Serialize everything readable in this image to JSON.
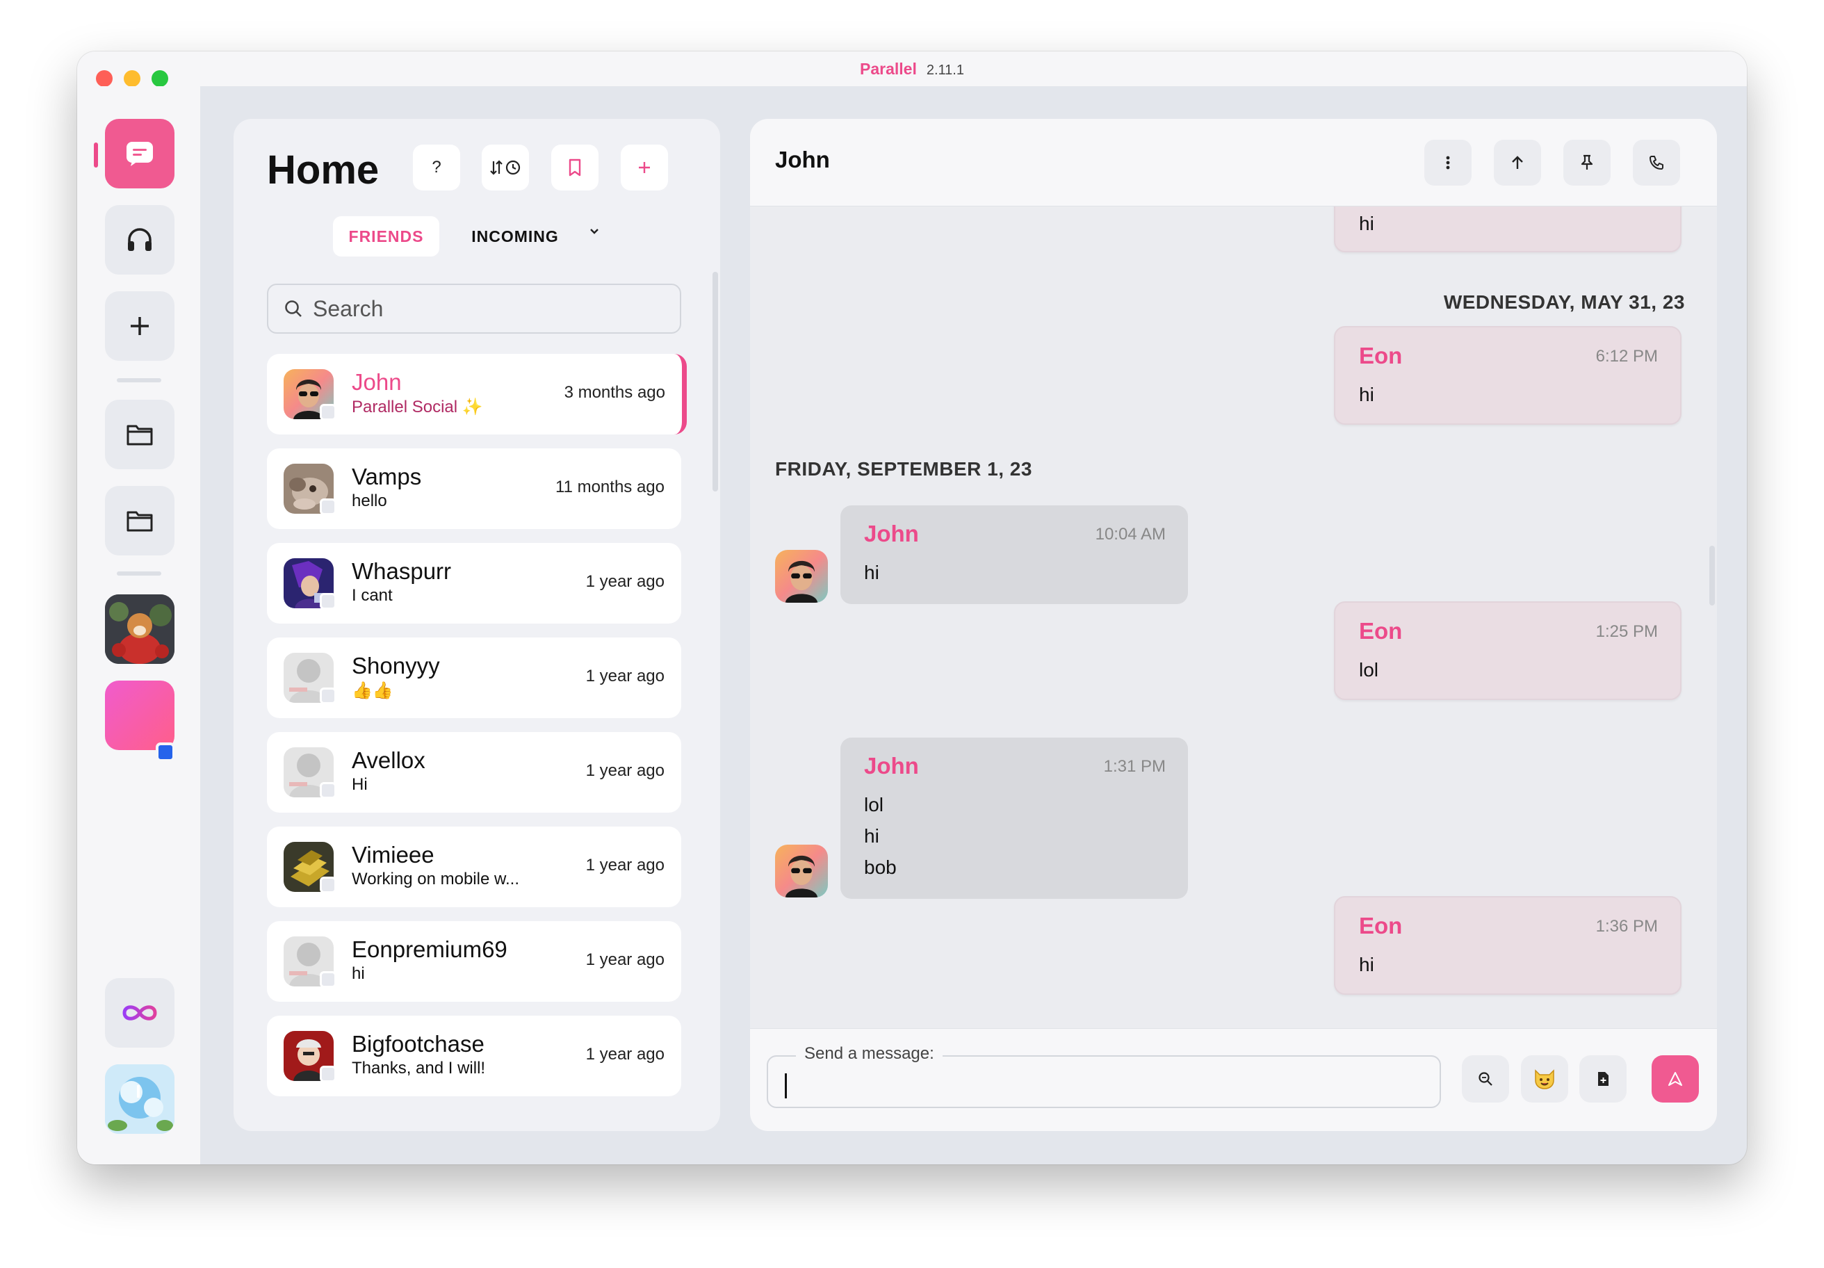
{
  "window": {
    "app_name": "Parallel",
    "version": "2.11.1"
  },
  "rail": {
    "items": [
      "chat-icon",
      "headphones-icon",
      "plus-icon",
      "folder-icon",
      "folder-icon",
      "server-shiba",
      "server-pink",
      "infinity-icon",
      "profile-avatar"
    ]
  },
  "home": {
    "title": "Home",
    "help_label": "?",
    "tabs": {
      "friends": "FRIENDS",
      "incoming": "INCOMING"
    },
    "search_placeholder": "Search",
    "friends": [
      {
        "name": "John",
        "status": "Parallel Social ✨",
        "time": "3 months ago",
        "active": true
      },
      {
        "name": "Vamps",
        "status": "hello",
        "time": "11 months ago"
      },
      {
        "name": "Whaspurr",
        "status": "I cant",
        "time": "1 year ago"
      },
      {
        "name": "Shonyyy",
        "status": "👍👍",
        "time": "1 year ago"
      },
      {
        "name": "Avellox",
        "status": "Hi",
        "time": "1 year ago"
      },
      {
        "name": "Vimieee",
        "status": "Working on mobile w...",
        "time": "1 year ago"
      },
      {
        "name": "Eonpremium69",
        "status": "hi",
        "time": "1 year ago"
      },
      {
        "name": "Bigfootchase",
        "status": "Thanks, and I will!",
        "time": "1 year ago"
      }
    ]
  },
  "chat": {
    "title": "John",
    "messages": {
      "top_partial_text": "hi",
      "date1": "WEDNESDAY, MAY 31, 23",
      "m1": {
        "author": "Eon",
        "time": "6:12 PM",
        "text": "hi"
      },
      "date2": "FRIDAY, SEPTEMBER 1, 23",
      "m2": {
        "author": "John",
        "time": "10:04 AM",
        "text": "hi"
      },
      "m3": {
        "author": "Eon",
        "time": "1:25 PM",
        "text": "lol"
      },
      "m4": {
        "author": "John",
        "time": "1:31 PM",
        "lines": [
          "lol",
          "hi",
          "bob"
        ]
      },
      "m5": {
        "author": "Eon",
        "time": "1:36 PM",
        "text": "hi"
      }
    },
    "composer": {
      "label": "Send a message:",
      "value": ""
    }
  },
  "colors": {
    "accent": "#ec4a8a",
    "own_bubble": "#eadde3",
    "other_bubble": "#d8d9dd"
  }
}
